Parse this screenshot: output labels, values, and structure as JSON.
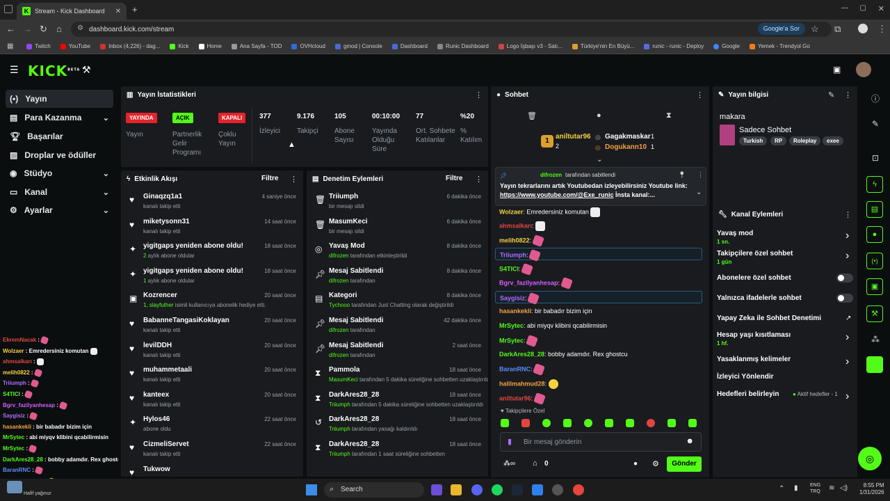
{
  "browser": {
    "tab_title": "Stream - Kick Dashboard",
    "url": "dashboard.kick.com/stream",
    "google_button": "Google'a Sor",
    "bookmarks": [
      "Twitch",
      "YouTube",
      "Inbox (4,226) - dag...",
      "Kick",
      "Home",
      "Ana Sayfa - TOD",
      "OVHcloud",
      "gmod | Console",
      "Dashboard",
      "Runic Dashboard",
      "Logo İşbaşı v3 - Satı...",
      "Türkiye'nin En Büyü...",
      "runic - runic - Deploy",
      "Google",
      "Yemek - Trendyol Go"
    ]
  },
  "kick": {
    "logo": "KICK",
    "beta": "BETA"
  },
  "sidebar": {
    "items": [
      {
        "label": "Yayın",
        "icon": "broadcast-icon"
      },
      {
        "label": "Para Kazanma",
        "icon": "money-icon"
      },
      {
        "label": "Başarılar",
        "icon": "trophy-icon"
      },
      {
        "label": "Droplar ve ödüller",
        "icon": "gift-icon"
      },
      {
        "label": "Stüdyo",
        "icon": "studio-icon"
      },
      {
        "label": "Kanal",
        "icon": "channel-icon"
      },
      {
        "label": "Ayarlar",
        "icon": "gear-icon"
      }
    ]
  },
  "stats": {
    "title": "Yayın İstatistikleri",
    "badges": [
      {
        "badge": "YAYINDA",
        "label": "Yayın"
      },
      {
        "badge": "AÇIK",
        "label": "Partnerlik Gelir Programı"
      },
      {
        "badge": "KAPALI",
        "label": "Çoklu Yayın"
      }
    ],
    "metrics": [
      {
        "value": "377",
        "label": "İzleyici"
      },
      {
        "value": "9.176",
        "label": "Takipçi"
      },
      {
        "value": "105",
        "label": "Abone Sayısı"
      },
      {
        "value": "00:10:00",
        "label": "Yayında Olduğu Süre"
      },
      {
        "value": "77",
        "label": "Ort. Sohbete Katılanlar"
      },
      {
        "value": "%20",
        "label": "% Katılım"
      }
    ]
  },
  "activity": {
    "title": "Etkinlik Akışı",
    "filter": "Filtre",
    "events": [
      {
        "icon": "heart-icon",
        "title": "Ginaqzq1a1",
        "sub": "kanalı takip etti",
        "time": "4 saniye önce"
      },
      {
        "icon": "heart-icon",
        "title": "miketysonn31",
        "sub": "kanalı takip etti",
        "time": "14 saat önce"
      },
      {
        "icon": "sparkle-icon",
        "title": "yigitgaps yeniden abone oldu!",
        "sub_hl": "2",
        "sub": " aylık abone oldular",
        "time": "18 saat önce"
      },
      {
        "icon": "sparkle-icon",
        "title": "yigitgaps yeniden abone oldu!",
        "sub_hl": "1",
        "sub": " aylık abone oldular",
        "time": "18 saat önce"
      },
      {
        "icon": "gift-icon",
        "title": "Kozrencer",
        "sub_hl": "1, slayfuther",
        "sub": " isimli kullanıcıya abonelik hediye etti.",
        "time": "20 saat önce"
      },
      {
        "icon": "heart-icon",
        "title": "BabanneTangasiKoklayan",
        "sub": "kanalı takip etti",
        "time": "20 saat önce"
      },
      {
        "icon": "heart-icon",
        "title": "levilDDH",
        "sub": "kanalı takip etti",
        "time": "20 saat önce"
      },
      {
        "icon": "heart-icon",
        "title": "muhammetaali",
        "sub": "kanalı takip etti",
        "time": "20 saat önce"
      },
      {
        "icon": "heart-icon",
        "title": "kanteex",
        "sub": "kanalı takip etti",
        "time": "20 saat önce"
      },
      {
        "icon": "sparkle-icon",
        "title": "Hylos46",
        "sub": "abone oldu",
        "time": "22 saat önce"
      },
      {
        "icon": "heart-icon",
        "title": "CizmeliServet",
        "sub": "kanalı takip etti",
        "time": "22 saat önce"
      },
      {
        "icon": "heart-icon",
        "title": "Tukwow",
        "sub": "",
        "time": ""
      }
    ]
  },
  "moderation": {
    "title": "Denetim Eylemleri",
    "filter": "Filtre",
    "events": [
      {
        "icon": "trash-icon",
        "title": "Triiumph",
        "sub_hl": "",
        "sub": "bir mesajı sildi",
        "time": "6 dakika önce"
      },
      {
        "icon": "trash-icon",
        "title": "MasumKeci",
        "sub_hl": "",
        "sub": "bir mesajı sildi",
        "time": "6 dakika önce"
      },
      {
        "icon": "snail-icon",
        "title": "Yavaş Mod",
        "sub_hl": "difrozen",
        "sub": " tarafından etkinleştirildi",
        "time": "8 dakika önce"
      },
      {
        "icon": "pin-icon",
        "title": "Mesaj Sabitlendi",
        "sub_hl": "difrozen",
        "sub": " tarafından",
        "time": "8 dakika önce"
      },
      {
        "icon": "category-icon",
        "title": "Kategori",
        "sub_hl": "Tychooo",
        "sub": " tarafından Just Chatting olarak değiştirildi",
        "time": "8 dakika önce"
      },
      {
        "icon": "pin-icon",
        "title": "Mesaj Sabitlendi",
        "sub_hl": "difrozen",
        "sub": " tarafından",
        "time": "42 dakika önce"
      },
      {
        "icon": "pin-icon",
        "title": "Mesaj Sabitlendi",
        "sub_hl": "difrozen",
        "sub": " tarafından",
        "time": "2 saat önce"
      },
      {
        "icon": "hourglass-icon",
        "title": "Pammola",
        "sub_hl": "MasumKeci",
        "sub": " tarafından 5 dakika süreliğine sohbetten uzaklaştırıldı",
        "time": "18 saat önce"
      },
      {
        "icon": "hourglass-icon",
        "title": "DarkAres28_28",
        "sub_hl": "Triiumph",
        "sub": " tarafından 5 dakika süreliğine sohbetten uzaklaştırıldı",
        "time": "18 saat önce"
      },
      {
        "icon": "undo-icon",
        "title": "DarkAres28_28",
        "sub_hl": "Triiumph",
        "sub": " tarafından yasağı kaldırıldı",
        "time": "18 saat önce"
      },
      {
        "icon": "hourglass-icon",
        "title": "DarkAres28_28",
        "sub_hl": "Triiumph",
        "sub": " tarafından 1 saat süreliğine sohbetten",
        "time": "18 saat önce"
      }
    ]
  },
  "chat": {
    "title": "Sohbet",
    "leaders": [
      {
        "rank": "1",
        "name": "aniltutar96",
        "count": "2"
      },
      {
        "rank": "",
        "name": "Gagakmaskar",
        "count": "1"
      },
      {
        "rank": "",
        "name": "Dogukann10",
        "count": "1"
      }
    ],
    "pinned_by": "difrozen",
    "pinned_label": "tarafından sabitlendi",
    "pinned_text": "Yayın tekrarlarını artık Youtubedan izleyebilirsiniz Youtube link: ",
    "pinned_link": "https://www.youtube.com/@Exe_runic",
    "pinned_tail": " İnsta kanal:...",
    "messages": [
      {
        "user": "Wolzaer",
        "color": "#f5d142",
        "text": " Emredersiniz komutan"
      },
      {
        "user": "ahmsalkarı",
        "color": "#e0463f",
        "text": ""
      },
      {
        "user": "melih0822",
        "color": "#f5d142",
        "text": ""
      },
      {
        "user": "Triiumph",
        "color": "#b06cff",
        "text": ""
      },
      {
        "user": "S4TICI",
        "color": "#53fc18",
        "text": ""
      },
      {
        "user": "Bgrv_fazilyanhesap",
        "color": "#d65cff",
        "text": ""
      },
      {
        "user": "Saygisiz",
        "color": "#b06cff",
        "text": ""
      },
      {
        "user": "hasankekli",
        "color": "#f5a142",
        "text": " bir babadır bizim için"
      },
      {
        "user": "MrSytec",
        "color": "#53fc18",
        "text": " abi miyqv klibini qcabilirmisin"
      },
      {
        "user": "MrSytec",
        "color": "#53fc18",
        "text": ""
      },
      {
        "user": "DarkAres28_28",
        "color": "#53fc18",
        "text": " bobby adamdır. Rex ghostcu"
      },
      {
        "user": "BaranRNC",
        "color": "#5a8dff",
        "text": ""
      },
      {
        "user": "halilmahmud28",
        "color": "#f5a142",
        "text": ""
      },
      {
        "user": "aniltutar96",
        "color": "#e0463f",
        "text": ""
      }
    ],
    "followers_only": "Takipçilere Özel",
    "input_placeholder": "Bir mesaj gönderin",
    "points": "0",
    "send": "Gönder"
  },
  "overlay_chat": [
    {
      "user": "EkremNacak",
      "color": "#e0463f",
      "text": ""
    },
    {
      "user": "Wolzaer",
      "color": "#f5d142",
      "text": " Emredersiniz komutan"
    },
    {
      "user": "ahmsalkarı",
      "color": "#e0463f",
      "text": ""
    },
    {
      "user": "melih0822",
      "color": "#f5d142",
      "text": ""
    },
    {
      "user": "Triiumph",
      "color": "#b06cff",
      "text": ""
    },
    {
      "user": "S4TICI",
      "color": "#53fc18",
      "text": ""
    },
    {
      "user": "Bgrv_fazilyanhesap",
      "color": "#d65cff",
      "text": ""
    },
    {
      "user": "Saygisiz",
      "color": "#b06cff",
      "text": ""
    },
    {
      "user": "hasankekli",
      "color": "#f5a142",
      "text": " bir babadır bizim için"
    },
    {
      "user": "MrSytec",
      "color": "#53fc18",
      "text": " abi miyqv klibini qcabilirmisin"
    },
    {
      "user": "MrSytec",
      "color": "#53fc18",
      "text": ""
    },
    {
      "user": "DarkAres28_28",
      "color": "#53fc18",
      "text": " bobby adamdır. Rex ghostcu"
    },
    {
      "user": "BaranRNC",
      "color": "#5a8dff",
      "text": ""
    },
    {
      "user": "halilmahmud28",
      "color": "#f5a142",
      "text": ""
    }
  ],
  "stream_info": {
    "title": "Yayın bilgisi",
    "stream_title": "makara",
    "category": "Sadece Sohbet",
    "tags": [
      "Turkish",
      "RP",
      "Roleplay",
      "exee"
    ]
  },
  "channel_actions": {
    "title": "Kanal Eylemleri",
    "items": [
      {
        "label": "Yavaş mod",
        "sub": "1 sn.",
        "control": "chevron"
      },
      {
        "label": "Takipçilere özel sohbet",
        "sub": "1 gün",
        "control": "chevron"
      },
      {
        "label": "Abonelere özel sohbet",
        "sub": "",
        "control": "toggle"
      },
      {
        "label": "Yalnızca ifadelerle sohbet",
        "sub": "",
        "control": "toggle"
      },
      {
        "label": "Yapay Zeka ile Sohbet Denetimi",
        "sub": "",
        "control": "external"
      },
      {
        "label": "Hesap yaşı kısıtlaması",
        "sub": "1 hf.",
        "control": "chevron"
      },
      {
        "label": "Yasaklanmış kelimeler",
        "sub": "",
        "control": "chevron"
      },
      {
        "label": "İzleyici Yönlendir",
        "sub": "",
        "control": ""
      },
      {
        "label": "Hedefleri belirleyin",
        "sub": "",
        "control": "chevron"
      }
    ],
    "goals_status": "Aktif hedefler - 1"
  },
  "taskbar": {
    "search": "Search",
    "lang": "ENG",
    "lang2": "TRQ",
    "time": "8:55 PM",
    "date": "1/31/2026",
    "weather": "Hafif yağmur"
  },
  "colors": {
    "accent": "#53fc18",
    "live": "#e3242b",
    "panel": "#191b1f",
    "bg": "#0b0e0f"
  }
}
